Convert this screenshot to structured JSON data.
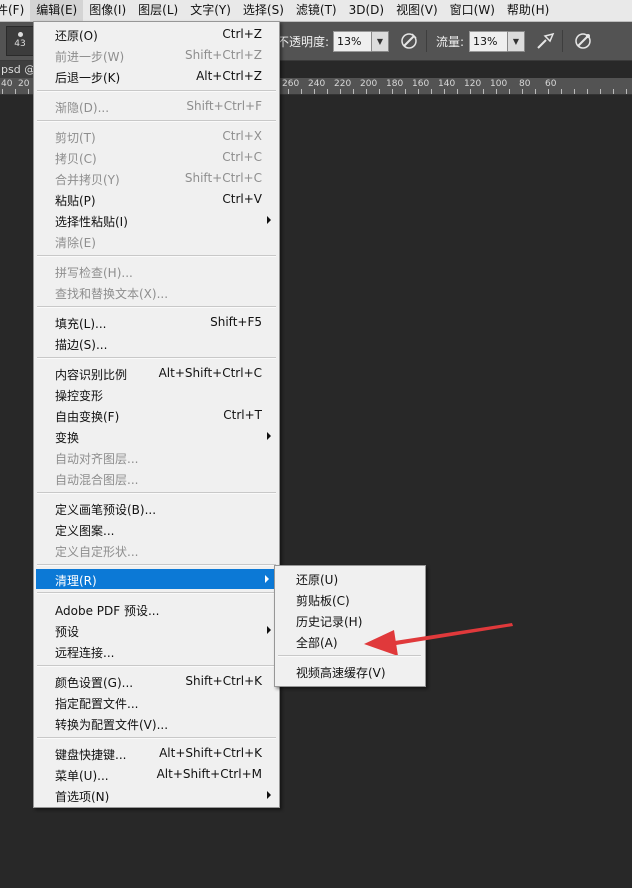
{
  "menubar": {
    "items": [
      {
        "label": "件(F)"
      },
      {
        "label": "编辑(E)",
        "active": true
      },
      {
        "label": "图像(I)"
      },
      {
        "label": "图层(L)"
      },
      {
        "label": "文字(Y)"
      },
      {
        "label": "选择(S)"
      },
      {
        "label": "滤镜(T)"
      },
      {
        "label": "3D(D)"
      },
      {
        "label": "视图(V)"
      },
      {
        "label": "窗口(W)"
      },
      {
        "label": "帮助(H)"
      }
    ]
  },
  "options_bar": {
    "brush_size": "43",
    "opacity_label": "不透明度:",
    "opacity_value": "13%",
    "flow_label": "流量:",
    "flow_value": "13%"
  },
  "document": {
    "tab_label": "psd @"
  },
  "ruler": {
    "left_labels": [
      "40",
      "20"
    ],
    "right_labels": [
      "260",
      "240",
      "220",
      "200",
      "180",
      "160",
      "140",
      "120",
      "100",
      "80",
      "60"
    ]
  },
  "edit_menu": {
    "items": [
      {
        "label": "还原(O)",
        "shortcut": "Ctrl+Z",
        "enabled": true
      },
      {
        "label": "前进一步(W)",
        "shortcut": "Shift+Ctrl+Z",
        "enabled": false
      },
      {
        "label": "后退一步(K)",
        "shortcut": "Alt+Ctrl+Z",
        "enabled": true
      },
      {
        "label": "渐隐(D)...",
        "shortcut": "Shift+Ctrl+F",
        "enabled": false
      },
      {
        "label": "剪切(T)",
        "shortcut": "Ctrl+X",
        "enabled": false
      },
      {
        "label": "拷贝(C)",
        "shortcut": "Ctrl+C",
        "enabled": false
      },
      {
        "label": "合并拷贝(Y)",
        "shortcut": "Shift+Ctrl+C",
        "enabled": false
      },
      {
        "label": "粘贴(P)",
        "shortcut": "Ctrl+V",
        "enabled": true
      },
      {
        "label": "选择性粘贴(I)",
        "shortcut": "",
        "enabled": true,
        "submenu": true
      },
      {
        "label": "清除(E)",
        "shortcut": "",
        "enabled": false
      },
      {
        "label": "拼写检查(H)...",
        "shortcut": "",
        "enabled": false
      },
      {
        "label": "查找和替换文本(X)...",
        "shortcut": "",
        "enabled": false
      },
      {
        "label": "填充(L)...",
        "shortcut": "Shift+F5",
        "enabled": true
      },
      {
        "label": "描边(S)...",
        "shortcut": "",
        "enabled": true
      },
      {
        "label": "内容识别比例",
        "shortcut": "Alt+Shift+Ctrl+C",
        "enabled": true
      },
      {
        "label": "操控变形",
        "shortcut": "",
        "enabled": true
      },
      {
        "label": "自由变换(F)",
        "shortcut": "Ctrl+T",
        "enabled": true
      },
      {
        "label": "变换",
        "shortcut": "",
        "enabled": true,
        "submenu": true
      },
      {
        "label": "自动对齐图层...",
        "shortcut": "",
        "enabled": false
      },
      {
        "label": "自动混合图层...",
        "shortcut": "",
        "enabled": false
      },
      {
        "label": "定义画笔预设(B)...",
        "shortcut": "",
        "enabled": true
      },
      {
        "label": "定义图案...",
        "shortcut": "",
        "enabled": true
      },
      {
        "label": "定义自定形状...",
        "shortcut": "",
        "enabled": false
      },
      {
        "label": "清理(R)",
        "shortcut": "",
        "enabled": true,
        "submenu": true,
        "highlighted": true
      },
      {
        "label": "Adobe PDF 预设...",
        "shortcut": "",
        "enabled": true
      },
      {
        "label": "预设",
        "shortcut": "",
        "enabled": true,
        "submenu": true
      },
      {
        "label": "远程连接...",
        "shortcut": "",
        "enabled": true
      },
      {
        "label": "颜色设置(G)...",
        "shortcut": "Shift+Ctrl+K",
        "enabled": true
      },
      {
        "label": "指定配置文件...",
        "shortcut": "",
        "enabled": true
      },
      {
        "label": "转换为配置文件(V)...",
        "shortcut": "",
        "enabled": true
      },
      {
        "label": "键盘快捷键...",
        "shortcut": "Alt+Shift+Ctrl+K",
        "enabled": true
      },
      {
        "label": "菜单(U)...",
        "shortcut": "Alt+Shift+Ctrl+M",
        "enabled": true
      },
      {
        "label": "首选项(N)",
        "shortcut": "",
        "enabled": true,
        "submenu": true
      }
    ]
  },
  "purge_submenu": {
    "items": [
      {
        "label": "还原(U)"
      },
      {
        "label": "剪贴板(C)"
      },
      {
        "label": "历史记录(H)"
      },
      {
        "label": "全部(A)"
      },
      {
        "label": "视频高速缓存(V)"
      }
    ]
  },
  "colors": {
    "highlight": "#0c79d6",
    "annotation_arrow": "#e0393b",
    "canvas": "#282828"
  },
  "icons": {
    "brush_tool": "airbrush-icon",
    "pressure_opacity": "pen-pressure-icon",
    "pressure_size": "tablet-pressure-icon"
  }
}
